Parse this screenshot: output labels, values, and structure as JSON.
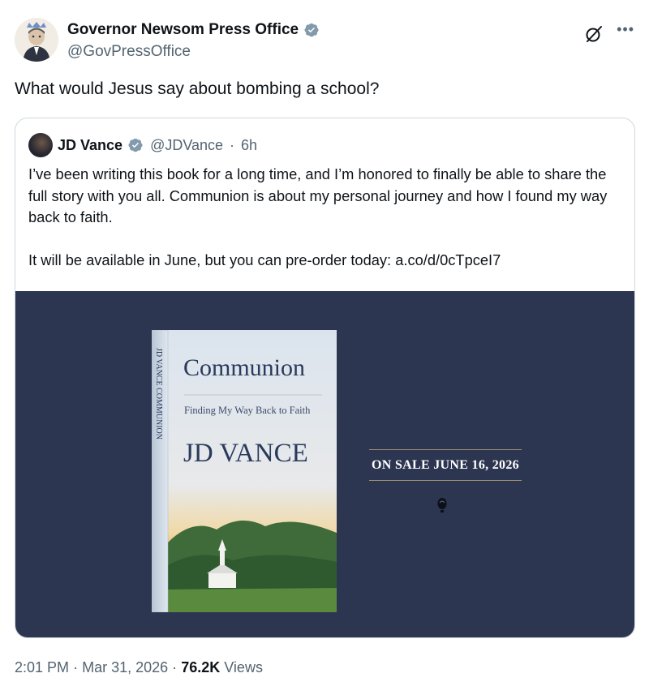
{
  "author": {
    "display_name": "Governor Newsom Press Office",
    "handle": "@GovPressOffice"
  },
  "tweet": {
    "text": "What would Jesus say about bombing a school?"
  },
  "quoted": {
    "display_name": "JD Vance",
    "handle": "@JDVance",
    "separator": "·",
    "time": "6h",
    "paragraph1": "I’ve been writing this book for a long time, and I’m honored to finally be able to share the full story with you all. Communion is about my personal journey and how I found my way back to faith.",
    "paragraph2": "It will be available in June, but you can pre-order today: a.co/d/0cTpceI7",
    "media": {
      "book_title": "Communion",
      "book_subtitle": "Finding My Way Back to Faith",
      "book_author": "JD VANCE",
      "spine_text": "JD VANCE  COMMUNION",
      "on_sale": "ON SALE JUNE 16, 2026",
      "background_color": "#2c3651"
    }
  },
  "footer": {
    "time": "2:01 PM",
    "sep1": "·",
    "date": "Mar 31, 2026",
    "sep2": "·",
    "views_count": "76.2K",
    "views_label": "Views"
  },
  "colors": {
    "verified": "#829aab",
    "secondary_text": "#536471",
    "border": "#cfd9de"
  },
  "icons": [
    "verified-badge-icon",
    "grok-icon",
    "more-icon",
    "publisher-logo-icon"
  ]
}
